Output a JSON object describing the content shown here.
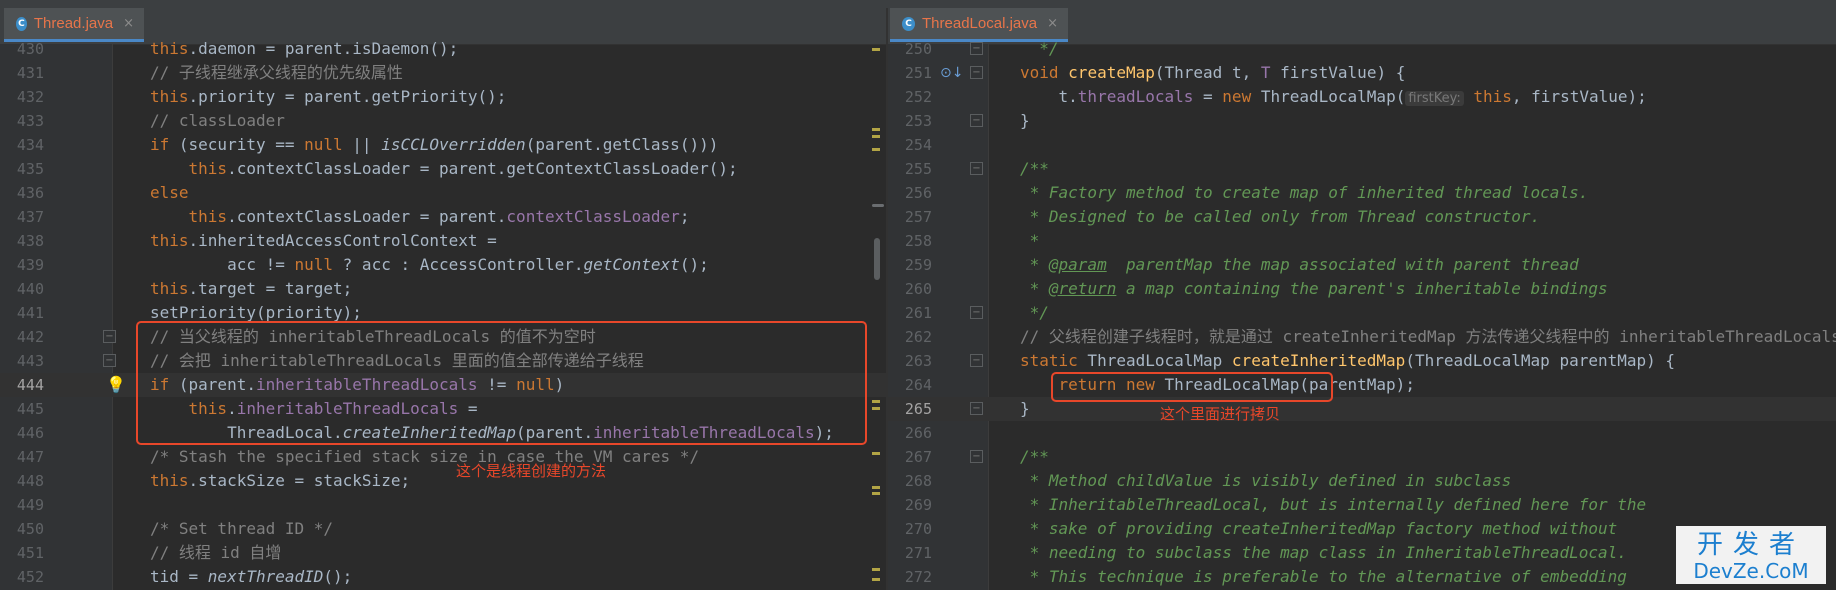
{
  "left_pane": {
    "tab": {
      "icon": "C",
      "title": "Thread.java",
      "close": "×"
    },
    "lines": [
      {
        "num": "430",
        "tokens": [
          {
            "k": "kw",
            "t": "this"
          },
          {
            "t": ".daemon = parent.isDaemon();"
          }
        ]
      },
      {
        "num": "431",
        "tokens": [
          {
            "k": "cm",
            "t": "// 子线程继承父线程的优先级属性"
          }
        ]
      },
      {
        "num": "432",
        "tokens": [
          {
            "k": "kw",
            "t": "this"
          },
          {
            "t": ".priority = parent.getPriority();"
          }
        ]
      },
      {
        "num": "433",
        "tokens": [
          {
            "k": "cm",
            "t": "// classLoader"
          }
        ]
      },
      {
        "num": "434",
        "tokens": [
          {
            "k": "kw",
            "t": "if"
          },
          {
            "t": " (security == "
          },
          {
            "k": "kw",
            "t": "null"
          },
          {
            "t": " || "
          },
          {
            "k": "st",
            "t": "isCCLOverridden"
          },
          {
            "t": "(parent.getClass()))"
          }
        ]
      },
      {
        "num": "435",
        "tokens": [
          {
            "t": "    "
          },
          {
            "k": "kw",
            "t": "this"
          },
          {
            "t": ".contextClassLoader = parent.getContextClassLoader();"
          }
        ]
      },
      {
        "num": "436",
        "tokens": [
          {
            "k": "kw",
            "t": "else"
          }
        ]
      },
      {
        "num": "437",
        "tokens": [
          {
            "t": "    "
          },
          {
            "k": "kw",
            "t": "this"
          },
          {
            "t": ".contextClassLoader = parent."
          },
          {
            "k": "field",
            "t": "contextClassLoader"
          },
          {
            "t": ";"
          }
        ]
      },
      {
        "num": "438",
        "tokens": [
          {
            "k": "kw",
            "t": "this"
          },
          {
            "t": ".inheritedAccessControlContext ="
          }
        ]
      },
      {
        "num": "439",
        "tokens": [
          {
            "t": "        acc != "
          },
          {
            "k": "kw",
            "t": "null"
          },
          {
            "t": " ? acc : AccessController."
          },
          {
            "k": "st",
            "t": "getContext"
          },
          {
            "t": "();"
          }
        ]
      },
      {
        "num": "440",
        "tokens": [
          {
            "k": "kw",
            "t": "this"
          },
          {
            "t": ".target = target;"
          }
        ]
      },
      {
        "num": "441",
        "tokens": [
          {
            "t": "setPriority(priority);"
          }
        ]
      },
      {
        "num": "442",
        "fold": "−",
        "tokens": [
          {
            "k": "cm",
            "t": "// 当父线程的 inheritableThreadLocals 的值不为空时"
          }
        ]
      },
      {
        "num": "443",
        "fold": "−",
        "tokens": [
          {
            "k": "cm",
            "t": "// 会把 inheritableThreadLocals 里面的值全部传递给子线程"
          }
        ]
      },
      {
        "num": "444",
        "current": true,
        "bulb": "💡",
        "tokens": [
          {
            "k": "kw",
            "t": "if"
          },
          {
            "t": " (parent."
          },
          {
            "k": "field",
            "t": "inheritableThreadLocals"
          },
          {
            "t": " != "
          },
          {
            "k": "kw",
            "t": "null"
          },
          {
            "t": ")"
          }
        ]
      },
      {
        "num": "445",
        "tokens": [
          {
            "t": "    "
          },
          {
            "k": "kw",
            "t": "this"
          },
          {
            "t": "."
          },
          {
            "k": "field",
            "t": "inheritableThreadLocals"
          },
          {
            "t": " ="
          }
        ]
      },
      {
        "num": "446",
        "tokens": [
          {
            "t": "        ThreadLocal."
          },
          {
            "k": "st",
            "t": "createInheritedMap"
          },
          {
            "t": "(parent."
          },
          {
            "k": "field",
            "t": "inheritableThreadLocals"
          },
          {
            "t": ");"
          }
        ]
      },
      {
        "num": "447",
        "tokens": [
          {
            "k": "cm",
            "t": "/* Stash the specified stack size in case the VM cares */"
          }
        ]
      },
      {
        "num": "448",
        "tokens": [
          {
            "k": "kw",
            "t": "this"
          },
          {
            "t": ".stackSize = stackSize;"
          }
        ]
      },
      {
        "num": "449",
        "tokens": []
      },
      {
        "num": "450",
        "tokens": [
          {
            "k": "cm",
            "t": "/* Set thread ID */"
          }
        ]
      },
      {
        "num": "451",
        "tokens": [
          {
            "k": "cm",
            "t": "// 线程 id 自增"
          }
        ]
      },
      {
        "num": "452",
        "tokens": [
          {
            "t": "tid = "
          },
          {
            "k": "st",
            "t": "nextThreadID"
          },
          {
            "t": "();"
          }
        ]
      }
    ],
    "annotation": "这个是线程创建的方法"
  },
  "right_pane": {
    "tab": {
      "icon": "C",
      "title": "ThreadLocal.java",
      "close": "×"
    },
    "lines": [
      {
        "num": "250",
        "fold": "−",
        "tokens": [
          {
            "k": "doc",
            "t": "  */"
          }
        ]
      },
      {
        "num": "251",
        "impl": "⊙↓",
        "fold": "−",
        "tokens": [
          {
            "k": "kw",
            "t": "void"
          },
          {
            "t": " "
          },
          {
            "k": "fn",
            "t": "createMap"
          },
          {
            "t": "(Thread t, "
          },
          {
            "k": "field",
            "t": "T"
          },
          {
            "t": " firstValue) {"
          }
        ]
      },
      {
        "num": "252",
        "tokens": [
          {
            "t": "    t."
          },
          {
            "k": "field",
            "t": "threadLocals"
          },
          {
            "t": " = "
          },
          {
            "k": "kw",
            "t": "new"
          },
          {
            "t": " ThreadLocalMap("
          },
          {
            "k": "hint",
            "t": "firstKey:"
          },
          {
            "t": " "
          },
          {
            "k": "kw",
            "t": "this"
          },
          {
            "t": ", firstValue);"
          }
        ]
      },
      {
        "num": "253",
        "fold": "−",
        "tokens": [
          {
            "t": "}"
          }
        ]
      },
      {
        "num": "254",
        "tokens": []
      },
      {
        "num": "255",
        "fold": "−",
        "tokens": [
          {
            "k": "doc",
            "t": "/**"
          }
        ]
      },
      {
        "num": "256",
        "tokens": [
          {
            "k": "doc",
            "t": " * Factory method to create map of inherited thread locals."
          }
        ]
      },
      {
        "num": "257",
        "tokens": [
          {
            "k": "doc",
            "t": " * Designed to be called only from Thread constructor."
          }
        ]
      },
      {
        "num": "258",
        "tokens": [
          {
            "k": "doc",
            "t": " *"
          }
        ]
      },
      {
        "num": "259",
        "tokens": [
          {
            "k": "doc",
            "t": " * "
          },
          {
            "k": "tag",
            "t": "@param"
          },
          {
            "k": "doc",
            "t": "  parentMap the map associated with parent thread"
          }
        ]
      },
      {
        "num": "260",
        "tokens": [
          {
            "k": "doc",
            "t": " * "
          },
          {
            "k": "tag",
            "t": "@return"
          },
          {
            "k": "doc",
            "t": " a map containing the parent's inheritable bindings"
          }
        ]
      },
      {
        "num": "261",
        "fold": "−",
        "tokens": [
          {
            "k": "doc",
            "t": " */"
          }
        ]
      },
      {
        "num": "262",
        "tokens": [
          {
            "k": "cm",
            "t": "// 父线程创建子线程时，就是通过 createInheritedMap 方法传递父线程中的 inheritableThreadLocals"
          }
        ]
      },
      {
        "num": "263",
        "fold": "−",
        "tokens": [
          {
            "k": "kw",
            "t": "static"
          },
          {
            "t": " ThreadLocalMap "
          },
          {
            "k": "fn",
            "t": "createInheritedMap"
          },
          {
            "t": "(ThreadLocalMap parentMap) {"
          }
        ]
      },
      {
        "num": "264",
        "tokens": [
          {
            "t": "    "
          },
          {
            "k": "kw",
            "t": "return new"
          },
          {
            "t": " ThreadLocalMap(parentMap);"
          }
        ]
      },
      {
        "num": "265",
        "current": true,
        "fold": "−",
        "tokens": [
          {
            "t": "}"
          }
        ]
      },
      {
        "num": "266",
        "tokens": []
      },
      {
        "num": "267",
        "fold": "−",
        "tokens": [
          {
            "k": "doc",
            "t": "/**"
          }
        ]
      },
      {
        "num": "268",
        "tokens": [
          {
            "k": "doc",
            "t": " * Method childValue is visibly defined in subclass"
          }
        ]
      },
      {
        "num": "269",
        "tokens": [
          {
            "k": "doc",
            "t": " * InheritableThreadLocal, but is internally defined here for the"
          }
        ]
      },
      {
        "num": "270",
        "tokens": [
          {
            "k": "doc",
            "t": " * sake of providing createInheritedMap factory method without"
          }
        ]
      },
      {
        "num": "271",
        "tokens": [
          {
            "k": "doc",
            "t": " * needing to subclass the map class in InheritableThreadLocal."
          }
        ]
      },
      {
        "num": "272",
        "tokens": [
          {
            "k": "doc",
            "t": " * This technique is preferable to the alternative of embedding"
          }
        ]
      }
    ],
    "annotation": "这个里面进行拷贝"
  },
  "watermark": {
    "cn": "开发者",
    "en": "DevZe.CoM"
  },
  "colors": {
    "keyword": "#cc7832",
    "comment": "#808080",
    "doc": "#629755",
    "field": "#9876aa",
    "function": "#ffc66d",
    "text": "#a9b7c6",
    "annotation": "#e8472a",
    "tab_title": "#e8754a"
  }
}
